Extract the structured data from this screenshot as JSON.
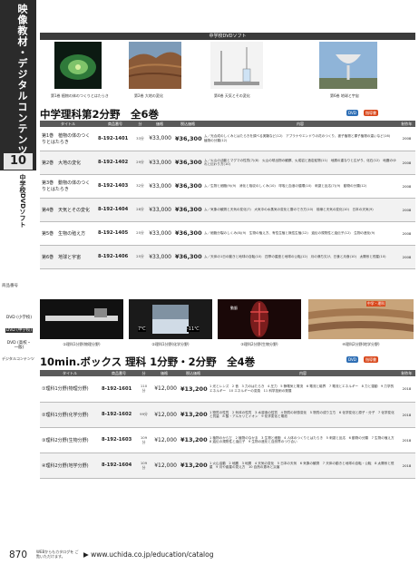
{
  "sidebar": {
    "vertical_title": "映像教材・デジタルコンテンツ",
    "chapter_number": "10",
    "category": "中学校DVDソフト",
    "note": "商品番号",
    "dvd_items": [
      {
        "label": "DVD (小学校)",
        "active": false
      },
      {
        "label": "DVD (中学校)",
        "active": true
      },
      {
        "label": "DVD (高校・一般)",
        "active": false
      }
    ],
    "digital": "デジタルコンテンツ"
  },
  "top_band": "中学校DVDソフト",
  "thumbs": [
    {
      "caption": "第1巻 植物の体のつくりとはたらき",
      "kind": "plant"
    },
    {
      "caption": "第2巻 大地の変化",
      "kind": "rock"
    },
    {
      "caption": "第4巻 天気とその変化",
      "kind": "weather"
    },
    {
      "caption": "第6巻 地球と宇宙",
      "kind": "dish"
    }
  ],
  "section1": {
    "title": "中学理科第2分野　全6巻",
    "badges": [
      "DVD",
      "指導書"
    ],
    "headers": [
      "タイトル",
      "商品番号",
      "分",
      "価格",
      "税込価格",
      "内容",
      "制作年"
    ],
    "rows": [
      {
        "name": "第1巻　植物の体のつくりとはたらき",
        "code": "8-192-1401",
        "min": "33分",
        "price": "¥33,000",
        "price_tax": "¥36,300",
        "desc": "ム／光合成のしくみとはたらきを調べる実験など(12)　アブラナやエンドウの花のつくり、被子植物と裸子植物の違いなど(16)　植物の分類(12)",
        "year": "2008"
      },
      {
        "name": "第2巻　大地の変化",
        "code": "8-192-1402",
        "min": "29分",
        "price": "¥33,000",
        "price_tax": "¥36,300",
        "desc": "ム／火山の活動とマグマの性質(7)(8)　火山の噴出物の観察、火成岩と造岩鉱物(11)　地層の重なりと広がり、化石(12)　地震のゆれと伝わり方(10)",
        "year": "2008"
      },
      {
        "name": "第3巻　動物の体のつくりとはたらき",
        "code": "8-192-1403",
        "min": "32分",
        "price": "¥33,000",
        "price_tax": "¥36,300",
        "desc": "ム／生物と細胞(9)(9)　消化と吸収のしくみ(10)　呼吸と血液の循環(10)　刺激と反応(7)(9)　動物の分類(12)",
        "year": "2008"
      },
      {
        "name": "第4巻　天気とその変化",
        "code": "8-192-1404",
        "min": "28分",
        "price": "¥33,000",
        "price_tax": "¥36,300",
        "desc": "ム／気象の観測と天気の変化(7)　大気中の水蒸気の変化と雲のでき方(10)　前線と天気の変化(10)　日本の天気(9)",
        "year": "2008"
      },
      {
        "name": "第5巻　生物の殖え方",
        "code": "8-192-1405",
        "min": "25分",
        "price": "¥33,000",
        "price_tax": "¥36,300",
        "desc": "ム／細胞分裂のしくみ(8)(9)　生物の殖え方、有性生殖と無性生殖(12)　遺伝の規則性と遺伝子(12)　生物の進化(9)",
        "year": "2008"
      },
      {
        "name": "第6巻　地球と宇宙",
        "code": "8-192-1406",
        "min": "25分",
        "price": "¥33,000",
        "price_tax": "¥36,300",
        "desc": "ム／天体の1日の動きと地球の自転(10)　四季の星座と地球の公転(12)　月の満ち欠け、日食と月食(10)　太陽系と恒星(10)",
        "year": "2008"
      }
    ]
  },
  "mid_images": [
    {
      "caption": "①理科1分野(物理分野)",
      "kind": "ruler"
    },
    {
      "caption": "②理科1分野(化学分野)",
      "kind": "beaker"
    },
    {
      "caption": "③理科2分野(生物分野)",
      "kind": "body"
    },
    {
      "caption": "④理科2分野(地学分野)",
      "kind": "strata"
    }
  ],
  "mid_labels": {
    "left_temp": "7℃",
    "right_temp": "-11℃",
    "body_label": "動脈",
    "tag": "中学・理科"
  },
  "section2": {
    "title": "10min.ボックス 理科 1分野・2分野　全4巻",
    "badges": [
      "DVD",
      "指導書"
    ],
    "headers": [
      "タイトル",
      "商品番号",
      "分",
      "価格",
      "税込価格",
      "内容",
      "制作年"
    ],
    "rows": [
      {
        "name": "①理科1分野(物理分野)",
        "code": "8-192-1601",
        "min": "110分",
        "price": "¥12,000",
        "price_tax": "¥13,200",
        "desc": "1 光とレンズ　2 音　3 力のはたらき　4 圧力　5 静電気と電流　6 電流と磁界　7 電流とエネルギー　8 力と運動　9 力学的エネルギー　10 エネルギーの変換　11 科学技術の発展",
        "year": "2018"
      },
      {
        "name": "②理科1分野(化学分野)",
        "code": "8-192-1602",
        "min": "99分",
        "price": "¥12,000",
        "price_tax": "¥13,200",
        "desc": "1 物質の性質　2 気体の性質　3 水溶液の性質　4 物質の状態変化　5 物質の成り立ち　6 化学変化と原子・分子　7 化学変化と質量　8 酸・アルカリとイオン　9 化学変化と電池",
        "year": "2018"
      },
      {
        "name": "③理科2分野(生物分野)",
        "code": "8-192-1603",
        "min": "109分",
        "price": "¥12,000",
        "price_tax": "¥13,200",
        "desc": "1 植物のからだ　2 植物のなかま　3 生物と細胞　4 人体のつくりとはたらき　5 刺激と反応　6 動物の分類　7 生物の殖え方　8 遺伝の規則性と遺伝子　9 生物の進化と自然界のつり合い",
        "year": "2018"
      },
      {
        "name": "④理科2分野(地学分野)",
        "code": "8-192-1604",
        "min": "109分",
        "price": "¥12,000",
        "price_tax": "¥13,200",
        "desc": "1 火山活動　2 地震　3 地層　4 天気の変化　5 日本の天気　6 気象の観測　7 天体の動きと地球の自転・公転　8 太陽系と恒星　9 月や惑星の見え方　10 自然の恵みと災害",
        "year": "2018"
      }
    ]
  },
  "footer": {
    "page_number": "870",
    "note": "WEBからもカタログを ご覧いただけます。",
    "url": "▶ www.uchida.co.jp/education/catalog"
  },
  "colors": {
    "dark": "#2b2b2b",
    "header": "#5a5a5a",
    "dvd_badge": "#2f6fb5",
    "guide_badge": "#d9481c"
  }
}
